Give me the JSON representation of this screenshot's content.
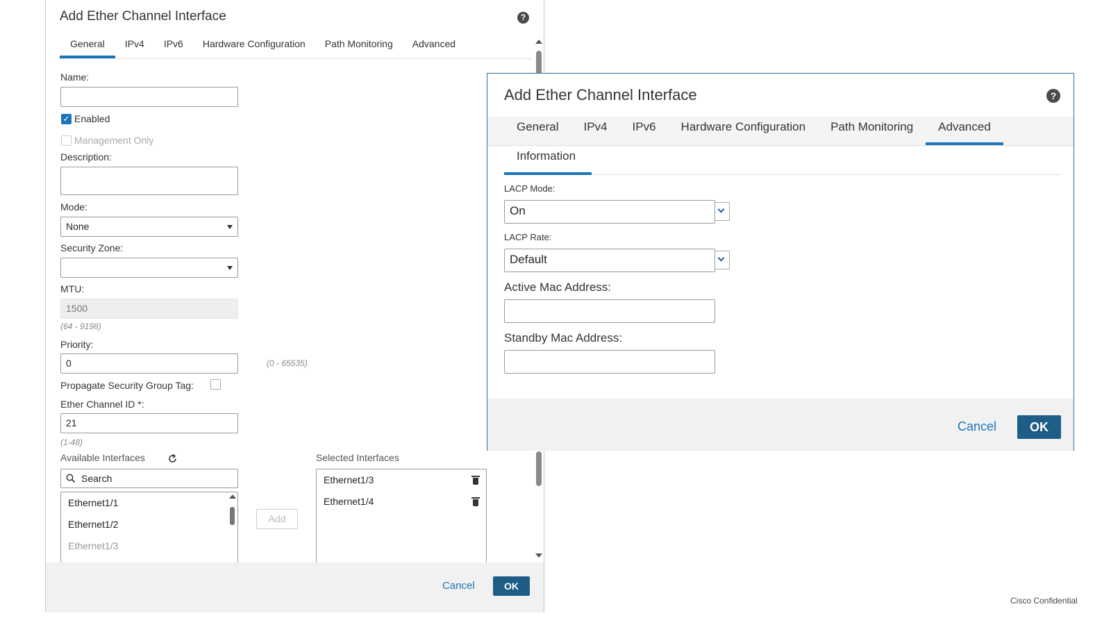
{
  "dialog_general": {
    "title": "Add Ether Channel Interface",
    "help_icon": "?",
    "tabs": [
      {
        "label": "General",
        "active": true
      },
      {
        "label": "IPv4",
        "active": false
      },
      {
        "label": "IPv6",
        "active": false
      },
      {
        "label": "Hardware Configuration",
        "active": false
      },
      {
        "label": "Path Monitoring",
        "active": false
      },
      {
        "label": "Advanced",
        "active": false
      }
    ],
    "name_label": "Name:",
    "name_value": "",
    "enabled_label": "Enabled",
    "enabled_checked": true,
    "management_only_label": "Management Only",
    "description_label": "Description:",
    "description_value": "",
    "mode_label": "Mode:",
    "mode_value": "None",
    "security_zone_label": "Security Zone:",
    "security_zone_value": "",
    "mtu_label": "MTU:",
    "mtu_value": "1500",
    "mtu_hint": "(64 - 9198)",
    "priority_label": "Priority:",
    "priority_value": "0",
    "priority_hint": "(0 - 65535)",
    "propagate_label": "Propagate Security Group Tag:",
    "ether_channel_id_label": "Ether Channel ID *:",
    "ether_channel_id_value": "21",
    "ether_channel_id_hint": "(1-48)",
    "available_label": "Available Interfaces",
    "search_placeholder": "Search",
    "available_interfaces": [
      "Ethernet1/1",
      "Ethernet1/2",
      "Ethernet1/3"
    ],
    "add_button": "Add",
    "selected_label": "Selected Interfaces",
    "selected_interfaces": [
      "Ethernet1/3",
      "Ethernet1/4"
    ],
    "cancel_button": "Cancel",
    "ok_button": "OK"
  },
  "dialog_advanced": {
    "title": "Add Ether Channel Interface",
    "help_icon": "?",
    "tabs": [
      {
        "label": "General",
        "active": false
      },
      {
        "label": "IPv4",
        "active": false
      },
      {
        "label": "IPv6",
        "active": false
      },
      {
        "label": "Hardware Configuration",
        "active": false
      },
      {
        "label": "Path Monitoring",
        "active": false
      },
      {
        "label": "Advanced",
        "active": true
      }
    ],
    "subtab": "Information",
    "lacp_mode_label": "LACP Mode:",
    "lacp_mode_value": "On",
    "lacp_rate_label": "LACP Rate:",
    "lacp_rate_value": "Default",
    "active_mac_label": "Active Mac Address:",
    "active_mac_value": "",
    "standby_mac_label": "Standby Mac Address:",
    "standby_mac_value": "",
    "cancel_button": "Cancel",
    "ok_button": "OK"
  },
  "footer_note": "Cisco Confidential",
  "colors": {
    "accent": "#1b76b9",
    "primary_button": "#1e5d86",
    "footer_bg": "#f1f1f1",
    "tab_bar_bg": "#f4f4f4"
  }
}
